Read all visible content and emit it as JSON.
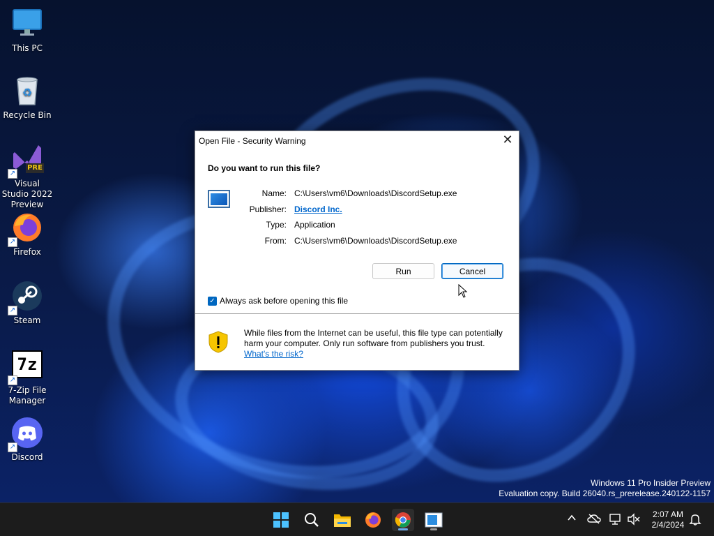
{
  "desktop": {
    "icons": [
      {
        "label": "This PC",
        "icon": "monitor-icon"
      },
      {
        "label": "Recycle Bin",
        "icon": "recycle-bin-icon"
      },
      {
        "label": "Visual Studio 2022 Preview",
        "icon": "visual-studio-icon",
        "badge": "PRE"
      },
      {
        "label": "Firefox",
        "icon": "firefox-icon"
      },
      {
        "label": "Steam",
        "icon": "steam-icon"
      },
      {
        "label": "7-Zip File Manager",
        "icon": "7zip-icon",
        "glyph": "7z"
      },
      {
        "label": "Discord",
        "icon": "discord-icon"
      }
    ]
  },
  "dialog": {
    "title": "Open File - Security Warning",
    "question": "Do you want to run this file?",
    "fields": [
      {
        "label": "Name:",
        "value": "C:\\Users\\vm6\\Downloads\\DiscordSetup.exe"
      },
      {
        "label": "Publisher:",
        "value": "Discord Inc."
      },
      {
        "label": "Type:",
        "value": "Application"
      },
      {
        "label": "From:",
        "value": "C:\\Users\\vm6\\Downloads\\DiscordSetup.exe"
      }
    ],
    "run_label": "Run",
    "cancel_label": "Cancel",
    "checkbox_label": "Always ask before opening this file",
    "checkbox_checked": true,
    "warning_text": "While files from the Internet can be useful, this file type can potentially harm your computer. Only run software from publishers you trust.",
    "risk_link": "What's the risk?"
  },
  "watermark": {
    "line1": "Windows 11 Pro Insider Preview",
    "line2": "Evaluation copy. Build 26040.rs_prerelease.240122-1157"
  },
  "taskbar": {
    "apps": [
      "start-icon",
      "search-icon",
      "file-explorer-icon",
      "firefox-icon",
      "chrome-icon",
      "security-warning-app-icon"
    ],
    "active_app": "chrome-icon",
    "time": "2:07 AM",
    "date": "2/4/2024"
  },
  "colors": {
    "accent": "#0067c0",
    "link": "#0066cc",
    "taskbar": "#1c1c1c"
  }
}
